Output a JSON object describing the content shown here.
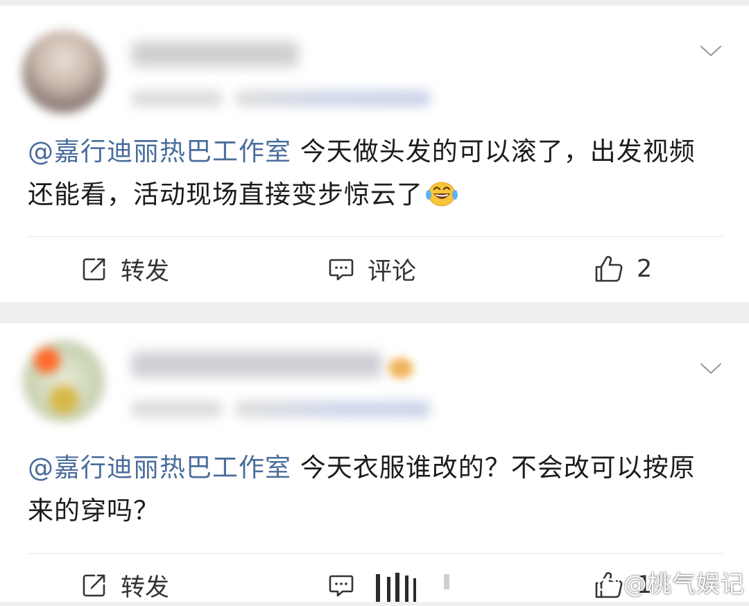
{
  "posts": [
    {
      "author_name": "",
      "author_badge": false,
      "text_mention": "@嘉行迪丽热巴工作室",
      "text_body": " 今天做头发的可以滚了，出发视频还能看，活动现场直接变步惊云了",
      "emoji": "laughing-tears-emoji",
      "actions": {
        "repost_label": "转发",
        "comment_label": "评论",
        "like_count": "2"
      }
    },
    {
      "author_name": "",
      "author_badge": true,
      "text_mention": "@嘉行迪丽热巴工作室",
      "text_body": " 今天衣服谁改的？不会改可以按原来的穿吗？",
      "actions": {
        "repost_label": "转发",
        "comment_label": "",
        "like_count": "1"
      }
    }
  ],
  "watermark": {
    "text": "@桃气娱记",
    "icon": "weibo-logo-icon"
  },
  "colors": {
    "mention": "#4a6d9c",
    "text": "#1c1c1c",
    "action_text": "#333333",
    "background": "#efefef",
    "card": "#ffffff"
  }
}
